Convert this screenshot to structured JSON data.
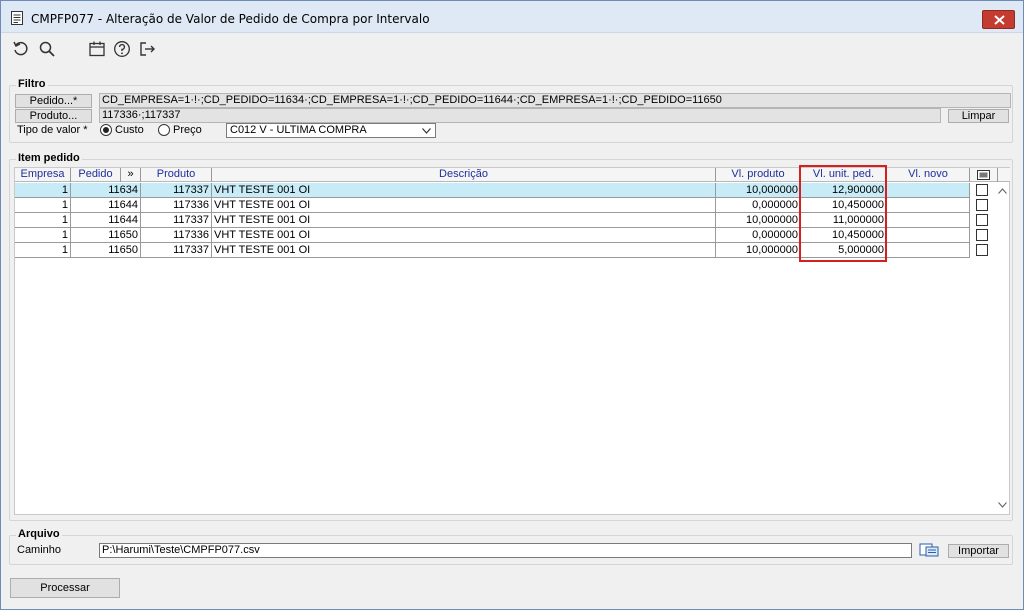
{
  "window": {
    "title": "CMPFP077 - Alteração de Valor de Pedido de Compra por Intervalo"
  },
  "toolbar": {
    "icons": [
      "undo-icon",
      "search-icon",
      "calendar-icon",
      "help-icon",
      "exit-icon"
    ]
  },
  "filtro": {
    "legend": "Filtro",
    "pedido_button": "Pedido...*",
    "pedido_value": "CD_EMPRESA=1·!·;CD_PEDIDO=11634·;CD_EMPRESA=1·!·;CD_PEDIDO=11644·;CD_EMPRESA=1·!·;CD_PEDIDO=11650",
    "produto_button": "Produto...",
    "produto_value": "117336·;117337",
    "limpar_button": "Limpar",
    "tipo_label": "Tipo de valor *",
    "radio_custo": "Custo",
    "radio_preco": "Preço",
    "select_value": "C012 V - ULTIMA COMPRA"
  },
  "item_pedido": {
    "legend": "Item pedido",
    "columns": {
      "empresa": "Empresa",
      "pedido": "Pedido",
      "expand": "»",
      "produto": "Produto",
      "descricao": "Descrição",
      "vl_produto": "Vl. produto",
      "vl_unit": "Vl. unit. ped.",
      "vl_novo": "Vl. novo"
    },
    "rows": [
      {
        "empresa": "1",
        "pedido": "11634",
        "produto": "117337",
        "descricao": "VHT TESTE 001 OI",
        "vl_produto": "10,000000",
        "vl_unit": "12,900000",
        "vl_novo": ""
      },
      {
        "empresa": "1",
        "pedido": "11644",
        "produto": "117336",
        "descricao": "VHT TESTE 001 OI",
        "vl_produto": "0,000000",
        "vl_unit": "10,450000",
        "vl_novo": ""
      },
      {
        "empresa": "1",
        "pedido": "11644",
        "produto": "117337",
        "descricao": "VHT TESTE 001 OI",
        "vl_produto": "10,000000",
        "vl_unit": "11,000000",
        "vl_novo": ""
      },
      {
        "empresa": "1",
        "pedido": "11650",
        "produto": "117336",
        "descricao": "VHT TESTE 001 OI",
        "vl_produto": "0,000000",
        "vl_unit": "10,450000",
        "vl_novo": ""
      },
      {
        "empresa": "1",
        "pedido": "11650",
        "produto": "117337",
        "descricao": "VHT TESTE 001 OI",
        "vl_produto": "10,000000",
        "vl_unit": "5,000000",
        "vl_novo": ""
      }
    ]
  },
  "arquivo": {
    "legend": "Arquivo",
    "caminho_label": "Caminho",
    "caminho_value": "P:\\Harumi\\Teste\\CMPFP077.csv",
    "importar_button": "Importar"
  },
  "footer": {
    "processar_button": "Processar"
  },
  "colors": {
    "selected_row": "#c7ecf7",
    "header_text": "#1f2f9c",
    "highlight_border": "#d61f1f",
    "close_button": "#c43c30"
  }
}
